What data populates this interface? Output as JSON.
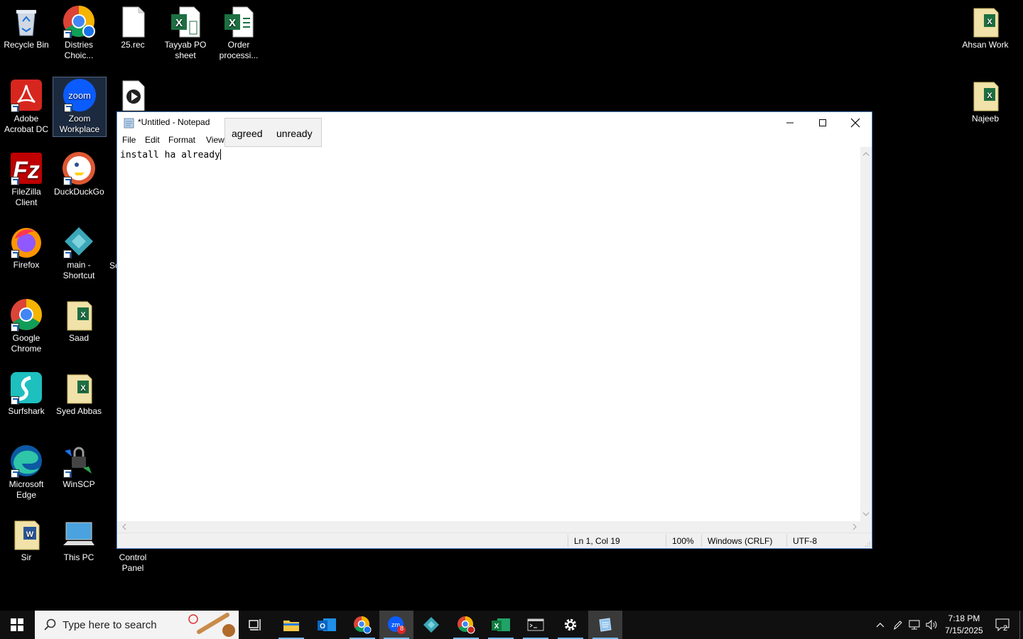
{
  "desktop": {
    "icons": [
      {
        "label": "Recycle Bin"
      },
      {
        "label": "Distries Choic..."
      },
      {
        "label": "25.rec"
      },
      {
        "label": "Tayyab PO sheet"
      },
      {
        "label": "Order processi..."
      },
      {
        "label": "Ahsan Work"
      },
      {
        "label": "Adobe Acrobat DC"
      },
      {
        "label": "Zoom Workplace"
      },
      {
        "label": "Najeeb"
      },
      {
        "label": "FileZilla Client"
      },
      {
        "label": "DuckDuckGo"
      },
      {
        "label": "Firefox"
      },
      {
        "label": "main - Shortcut"
      },
      {
        "label": "Google Chrome"
      },
      {
        "label": "Saad"
      },
      {
        "label": "Surfshark"
      },
      {
        "label": "Syed Abbas"
      },
      {
        "label": "Microsoft Edge"
      },
      {
        "label": "WinSCP"
      },
      {
        "label": "Sir"
      },
      {
        "label": "This PC"
      },
      {
        "label": "Control Panel"
      }
    ],
    "partial_label": "Sc"
  },
  "notepad": {
    "title": "*Untitled - Notepad",
    "menu": [
      "File",
      "Edit",
      "Format",
      "View"
    ],
    "content": "install ha already",
    "status": {
      "position": "Ln 1, Col 19",
      "zoom": "100%",
      "line_ending": "Windows (CRLF)",
      "encoding": "UTF-8"
    }
  },
  "suggestions": [
    "agreed",
    "unready"
  ],
  "taskbar": {
    "search_placeholder": "Type here to search",
    "zoom_badge": "8",
    "clock_time": "7:18 PM",
    "clock_date": "7/15/2025",
    "notification_count": "2"
  },
  "colors": {
    "accent": "#76b9ed",
    "excel": "#1d6f42",
    "zoom": "#0b5cff"
  }
}
